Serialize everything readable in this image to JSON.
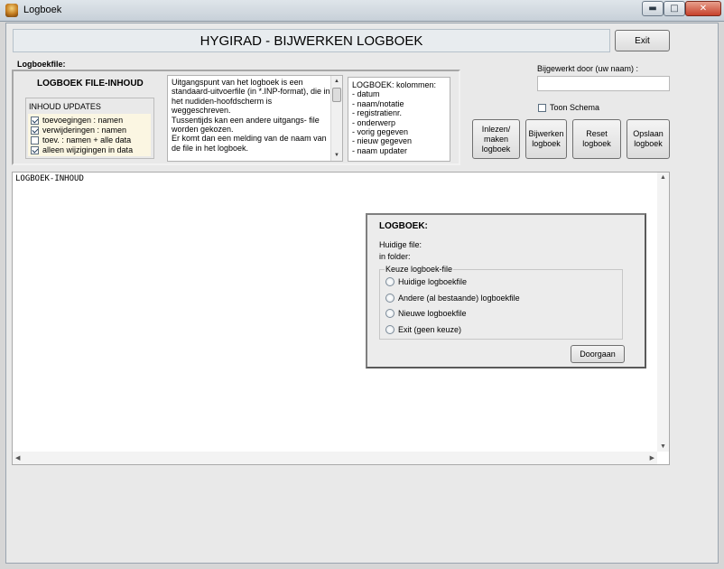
{
  "window": {
    "title": "Logboek",
    "controls": {
      "minimize": "▬",
      "maximize": "□",
      "close": "✕"
    }
  },
  "header": {
    "title": "HYGIRAD - BIJWERKEN LOGBOEK",
    "exit_label": "Exit"
  },
  "file_section": {
    "label": "Logboekfile:",
    "title": "LOGBOEK FILE-INHOUD",
    "updates_legend": "INHOUD UPDATES",
    "updates": [
      {
        "label": "toevoegingen : namen",
        "checked": true
      },
      {
        "label": "verwijderingen : namen",
        "checked": true
      },
      {
        "label": "toev. : namen + alle data",
        "checked": false
      },
      {
        "label": "alleen wijzigingen in data",
        "checked": true
      }
    ],
    "info_text": "Uitgangspunt van het logboek is een standaard-uitvoerfile (in *.INP-format), die in het nudiden-hoofdscherm is weggeschreven.\nTussentijds kan een andere uitgangs- file worden gekozen.\nEr komt dan een melding van de naam van de file  in het logboek.",
    "columns_text": "LOGBOEK: kolommen:\n- datum\n- naam/notatie\n- registratienr.\n- onderwerp\n- vorig gegeven\n- nieuw gegeven\n- naam updater"
  },
  "user": {
    "label": "Bijgewerkt door (uw naam) :",
    "value": "",
    "toon_schema_label": "Toon Schema",
    "toon_schema_checked": false
  },
  "actions": {
    "inlezen": "Inlezen/\nmaken\nlogboek",
    "bijwerken": "Bijwerken\nlogboek",
    "reset": "Reset\nlogboek",
    "opslaan": "Opslaan\nlogboek"
  },
  "log": {
    "content": "LOGBOEK-INHOUD"
  },
  "dialog": {
    "title": "LOGBOEK:",
    "current_file_label": "Huidige file:",
    "folder_label": "in folder:",
    "choice_legend": "Keuze logboek-file",
    "options": [
      "Huidige logboekfile",
      "Andere (al bestaande) logboekfile",
      "Nieuwe logboekfile",
      "Exit (geen keuze)"
    ],
    "continue_label": "Doorgaan"
  }
}
